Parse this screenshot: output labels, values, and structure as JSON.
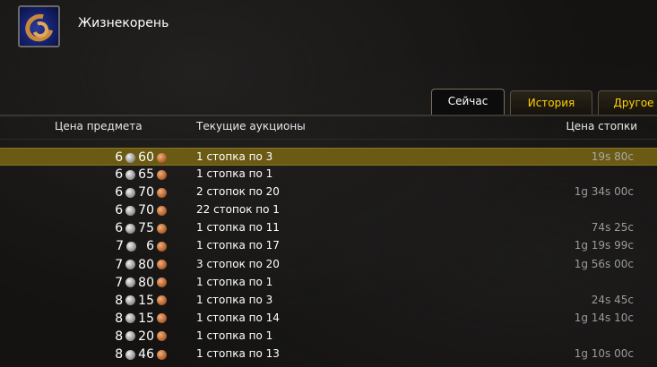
{
  "item": {
    "name": "Жизнекорень",
    "icon": "liferoot-icon"
  },
  "tabs": [
    {
      "label": "Сейчас",
      "active": true
    },
    {
      "label": "История",
      "active": false
    },
    {
      "label": "Другое",
      "active": false
    }
  ],
  "columns": {
    "price": "Цена предмета",
    "auctions": "Текущие аукционы",
    "stack_price": "Цена стопки"
  },
  "colors": {
    "selected_row": "#6b5a14",
    "tab_inactive_text": "#ffd100"
  },
  "rows": [
    {
      "silver": "6",
      "copper": "60",
      "auctions": "1 стопка по 3",
      "stack_price": "19s 80c",
      "selected": true
    },
    {
      "silver": "6",
      "copper": "65",
      "auctions": "1 стопка по 1",
      "stack_price": ""
    },
    {
      "silver": "6",
      "copper": "70",
      "auctions": "2 стопок по 20",
      "stack_price": "1g 34s 00c"
    },
    {
      "silver": "6",
      "copper": "70",
      "auctions": "22 стопок по 1",
      "stack_price": ""
    },
    {
      "silver": "6",
      "copper": "75",
      "auctions": "1 стопка по 11",
      "stack_price": "74s 25c"
    },
    {
      "silver": "7",
      "copper": "6",
      "auctions": "1 стопка по 17",
      "stack_price": "1g 19s 99c"
    },
    {
      "silver": "7",
      "copper": "80",
      "auctions": "3 стопок по 20",
      "stack_price": "1g 56s 00c"
    },
    {
      "silver": "7",
      "copper": "80",
      "auctions": "1 стопка по 1",
      "stack_price": ""
    },
    {
      "silver": "8",
      "copper": "15",
      "auctions": "1 стопка по 3",
      "stack_price": "24s 45c"
    },
    {
      "silver": "8",
      "copper": "15",
      "auctions": "1 стопка по 14",
      "stack_price": "1g 14s 10c"
    },
    {
      "silver": "8",
      "copper": "20",
      "auctions": "1 стопка по 1",
      "stack_price": ""
    },
    {
      "silver": "8",
      "copper": "46",
      "auctions": "1 стопка по 13",
      "stack_price": "1g 10s 00c"
    }
  ]
}
